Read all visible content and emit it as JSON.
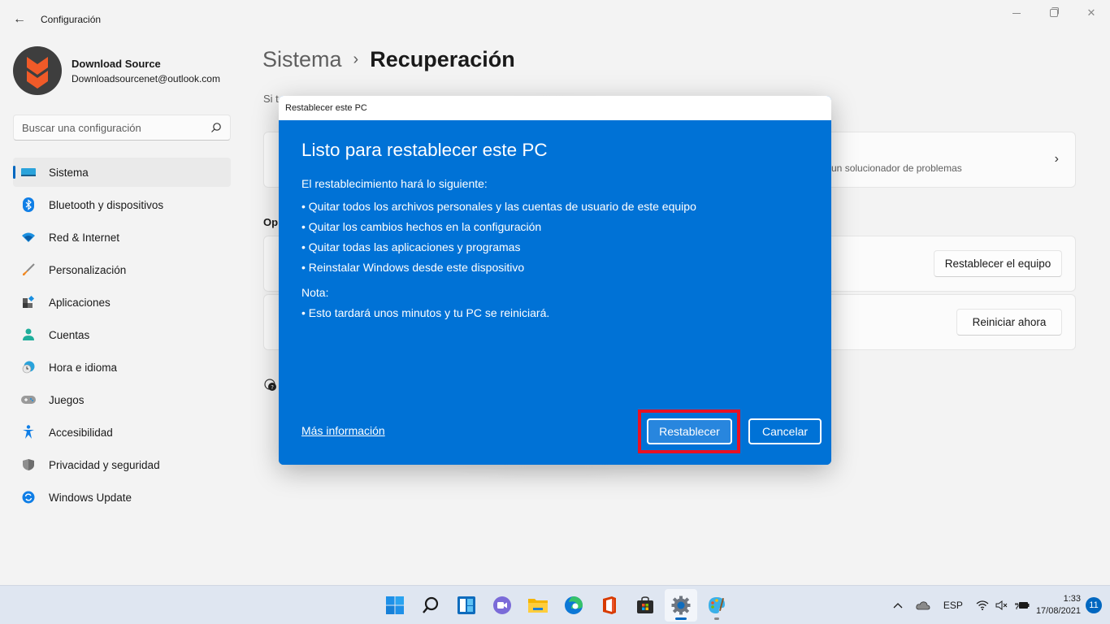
{
  "window": {
    "app_title": "Configuración",
    "back_icon": "arrow-left-icon",
    "controls": [
      "minimize-icon",
      "restore-icon",
      "close-icon"
    ]
  },
  "profile": {
    "name": "Download Source",
    "email": "Downloadsourcenet@outlook.com"
  },
  "search": {
    "placeholder": "Buscar una configuración",
    "value": ""
  },
  "sidebar": {
    "items": [
      {
        "label": "Sistema",
        "icon": "system-monitor-icon",
        "active": true
      },
      {
        "label": "Bluetooth y dispositivos",
        "icon": "bluetooth-icon"
      },
      {
        "label": "Red & Internet",
        "icon": "wifi-icon"
      },
      {
        "label": "Personalización",
        "icon": "paintbrush-icon"
      },
      {
        "label": "Aplicaciones",
        "icon": "apps-icon"
      },
      {
        "label": "Cuentas",
        "icon": "person-icon"
      },
      {
        "label": "Hora e idioma",
        "icon": "clock-globe-icon"
      },
      {
        "label": "Juegos",
        "icon": "gamepad-icon"
      },
      {
        "label": "Accesibilidad",
        "icon": "accessibility-icon"
      },
      {
        "label": "Privacidad y seguridad",
        "icon": "shield-icon"
      },
      {
        "label": "Windows Update",
        "icon": "refresh-icon"
      }
    ]
  },
  "main": {
    "breadcrumb": {
      "parent": "Sistema",
      "separator": "›",
      "current": "Recuperación"
    },
    "intro_visible": "Si t",
    "card1_sub_visible": "e un solucionador de problemas",
    "section_label_visible": "Op",
    "reset_button": "Restablecer el equipo",
    "restart_button": "Reiniciar ahora"
  },
  "dialog": {
    "title": "Restablecer este PC",
    "heading": "Listo para restablecer este PC",
    "intro": "El restablecimiento hará lo siguiente:",
    "items": [
      "•  Quitar todos los archivos personales y las cuentas de usuario de este equipo",
      "•  Quitar los cambios hechos en la configuración",
      "•  Quitar todas las aplicaciones y programas",
      "• Reinstalar Windows desde este dispositivo"
    ],
    "note_label": "Nota:",
    "note": "• Esto tardará unos minutos y tu PC se reiniciará.",
    "more_info_link": "Más información",
    "primary_button": "Restablecer",
    "cancel_button": "Cancelar",
    "highlight_color": "#e81123",
    "background_color": "#0072d6"
  },
  "taskbar": {
    "apps": [
      {
        "name": "start-icon"
      },
      {
        "name": "search-icon"
      },
      {
        "name": "widgets-icon"
      },
      {
        "name": "teams-chat-icon"
      },
      {
        "name": "file-explorer-icon"
      },
      {
        "name": "edge-icon"
      },
      {
        "name": "office-icon"
      },
      {
        "name": "store-icon"
      },
      {
        "name": "settings-icon",
        "active": true
      },
      {
        "name": "paint-icon",
        "running": true
      }
    ],
    "tray": {
      "language": "ESP",
      "time": "1:33",
      "date": "17/08/2021",
      "notifications": "11"
    }
  }
}
